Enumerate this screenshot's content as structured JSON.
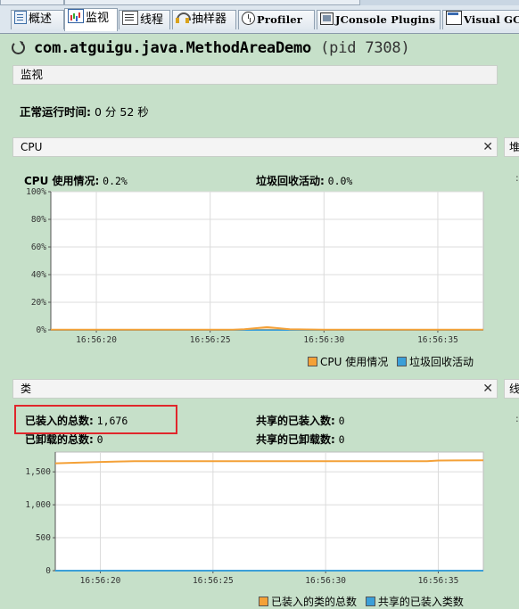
{
  "tabs": [
    {
      "label": "概述",
      "icon": "overview-icon"
    },
    {
      "label": "监视",
      "icon": "monitor-chart-icon"
    },
    {
      "label": "线程",
      "icon": "threads-icon"
    },
    {
      "label": "抽样器",
      "icon": "sampler-icon"
    },
    {
      "label": "Profiler",
      "icon": "profiler-clock-icon"
    },
    {
      "label": "JConsole Plugins",
      "icon": "jconsole-icon"
    },
    {
      "label": "Visual GC",
      "icon": "visual-gc-icon"
    }
  ],
  "active_tab": "监视",
  "process": {
    "name": "com.atguigu.java.MethodAreaDemo",
    "pid_label": "(pid 7308)"
  },
  "section_title": "监视",
  "uptime": {
    "label": "正常运行时间:",
    "value": "0 分 52 秒"
  },
  "cpu_panel": {
    "title": "CPU",
    "usage_label": "CPU 使用情况:",
    "usage_value": "0.2%",
    "gc_label": "垃圾回收活动:",
    "gc_value": "0.0%",
    "legend": [
      "CPU 使用情况",
      "垃圾回收活动"
    ],
    "side_head": "堆",
    "colors": {
      "cpu": "#f4a138",
      "gc": "#3b9fd8"
    }
  },
  "classes_panel": {
    "title": "类",
    "loaded_label": "已装入的总数:",
    "loaded_value": "1,676",
    "unloaded_label": "已卸载的总数:",
    "unloaded_value": "0",
    "shared_loaded_label": "共享的已装入数:",
    "shared_loaded_value": "0",
    "shared_unloaded_label": "共享的已卸载数:",
    "shared_unloaded_value": "0",
    "legend": [
      "已装入的类的总数",
      "共享的已装入类数"
    ],
    "side_head": "线",
    "colors": {
      "loaded": "#f4a138",
      "shared": "#3b9fd8"
    }
  },
  "chart_data": [
    {
      "type": "area",
      "x": [
        "16:56:18",
        "16:56:20",
        "16:56:22",
        "16:56:24",
        "16:56:26",
        "16:56:26.5",
        "16:56:27.5",
        "16:56:28.5",
        "16:56:30",
        "16:56:32",
        "16:56:34",
        "16:56:36",
        "16:56:37"
      ],
      "xticks": [
        "16:56:20",
        "16:56:25",
        "16:56:30",
        "16:56:35"
      ],
      "yticks": [
        "0%",
        "20%",
        "40%",
        "60%",
        "80%",
        "100%"
      ],
      "ylim": [
        0,
        100
      ],
      "series": [
        {
          "name": "CPU 使用情况",
          "values": [
            0.2,
            0.2,
            0.2,
            0.2,
            0.2,
            0.5,
            2.0,
            0.5,
            0.2,
            0.2,
            0.2,
            0.2,
            0.2
          ]
        },
        {
          "name": "垃圾回收活动",
          "values": [
            0,
            0,
            0,
            0,
            0,
            0,
            0,
            0,
            0,
            0,
            0,
            0,
            0
          ]
        }
      ]
    },
    {
      "type": "line",
      "x": [
        "16:56:18",
        "16:56:20",
        "16:56:21.5",
        "16:56:23",
        "16:56:25",
        "16:56:27",
        "16:56:29",
        "16:56:31",
        "16:56:33",
        "16:56:34.5",
        "16:56:35",
        "16:56:37",
        "16:56:39"
      ],
      "xticks": [
        "16:56:20",
        "16:56:25",
        "16:56:30",
        "16:56:35"
      ],
      "yticks": [
        "0",
        "500",
        "1,000",
        "1,500"
      ],
      "ylim": [
        0,
        1800
      ],
      "series": [
        {
          "name": "已装入的类的总数",
          "values": [
            1630,
            1650,
            1660,
            1660,
            1660,
            1660,
            1660,
            1660,
            1660,
            1660,
            1672,
            1676,
            1676
          ]
        },
        {
          "name": "共享的已装入类数",
          "values": [
            0,
            0,
            0,
            0,
            0,
            0,
            0,
            0,
            0,
            0,
            0,
            0,
            0
          ]
        }
      ]
    }
  ]
}
